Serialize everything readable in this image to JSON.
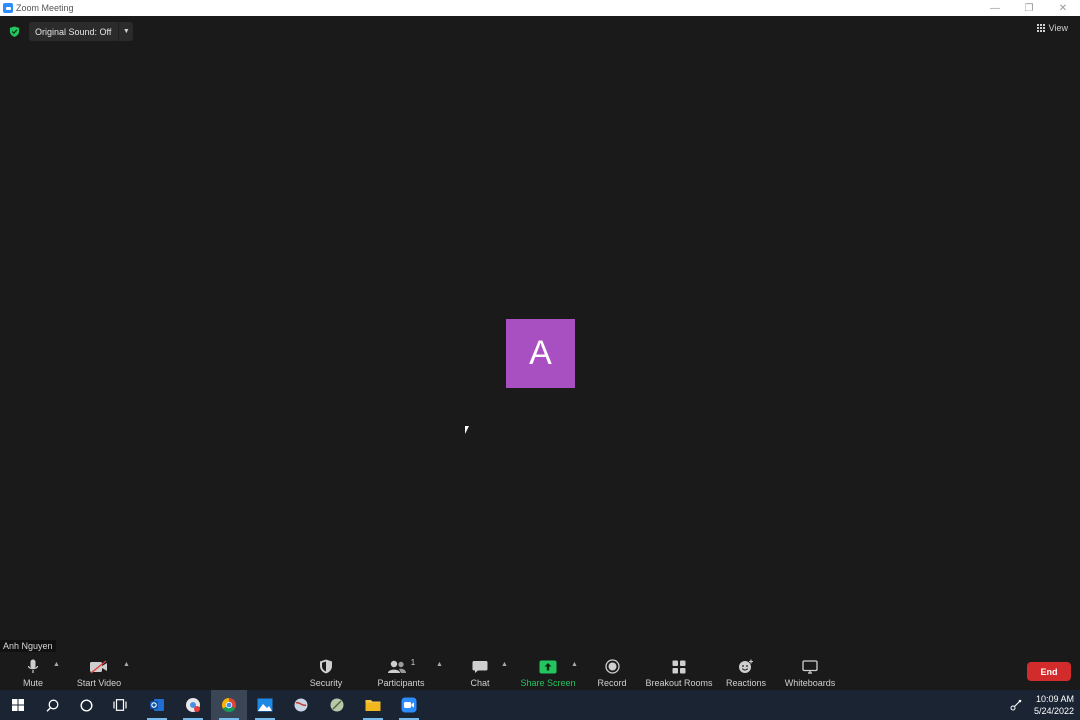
{
  "window": {
    "title": "Zoom Meeting"
  },
  "topbar": {
    "original_sound_label": "Original Sound: Off",
    "view_label": "View"
  },
  "participant": {
    "initial": "A",
    "name": "Anh Nguyen",
    "avatar_color": "#a84fc1"
  },
  "toolbar": {
    "mute": "Mute",
    "start_video": "Start Video",
    "security": "Security",
    "participants": "Participants",
    "participants_count": "1",
    "chat": "Chat",
    "share_screen": "Share Screen",
    "record": "Record",
    "breakout_rooms": "Breakout Rooms",
    "reactions": "Reactions",
    "whiteboards": "Whiteboards",
    "end": "End"
  },
  "taskbar": {
    "time": "10:09 AM",
    "date": "5/24/2022"
  },
  "colors": {
    "end": "#d12b2b",
    "share": "#22c55e",
    "accent": "#2d8cff"
  }
}
